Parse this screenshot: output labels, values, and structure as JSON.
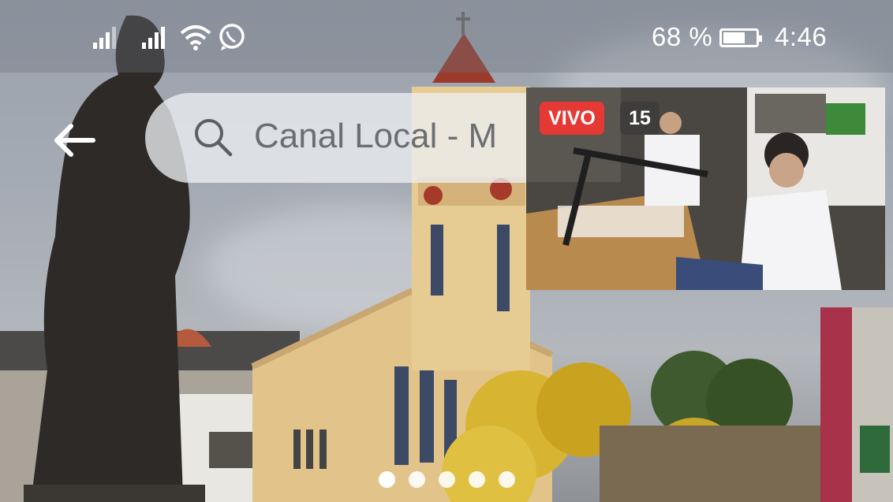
{
  "status_bar": {
    "battery_pct": "68 %",
    "time": "4:46",
    "battery_level": 0.68
  },
  "search": {
    "query": "Canal Local - M"
  },
  "live_video": {
    "live_label": "VIVO",
    "viewer_count": "15"
  },
  "carousel": {
    "page_count": 5,
    "active_index": 0
  }
}
